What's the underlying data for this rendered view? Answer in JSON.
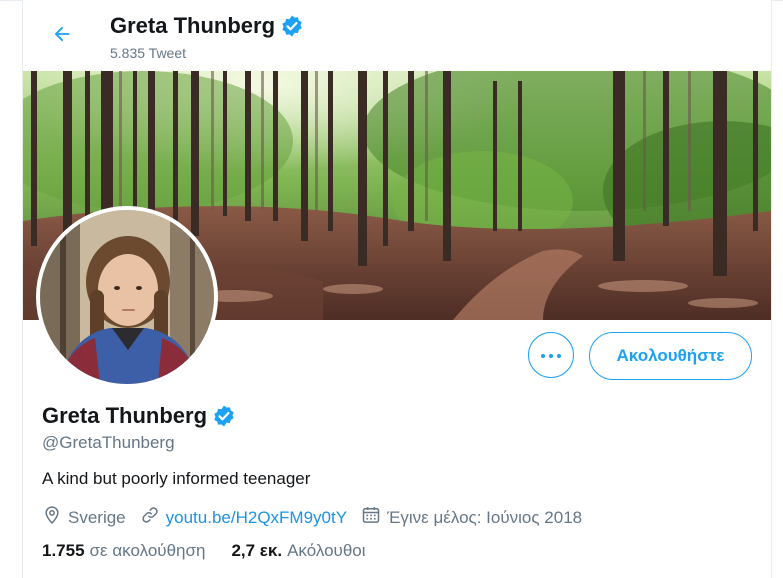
{
  "header": {
    "name": "Greta Thunberg",
    "tweet_count": "5.835 Tweet"
  },
  "icons": {
    "back": "arrow-left-icon",
    "verified": "verified-badge-icon",
    "more": "more-options-icon",
    "location": "location-pin-icon",
    "link": "link-icon",
    "calendar": "calendar-icon"
  },
  "colors": {
    "accent": "#1da1f2",
    "link": "#1b95e0",
    "secondary_text": "#657786",
    "primary_text": "#14171a"
  },
  "actions": {
    "follow_label": "Ακολουθήστε"
  },
  "profile": {
    "name": "Greta Thunberg",
    "handle": "@GretaThunberg",
    "bio": "A kind but poorly informed teenager",
    "location": "Sverige",
    "website": "youtu.be/H2QxFM9y0tY",
    "joined": "Έγινε μέλος: Ιούνιος 2018"
  },
  "stats": {
    "following_count": "1.755",
    "following_label": "σε ακολούθηση",
    "followers_count": "2,7 εκ.",
    "followers_label": "Ακόλουθοι"
  }
}
